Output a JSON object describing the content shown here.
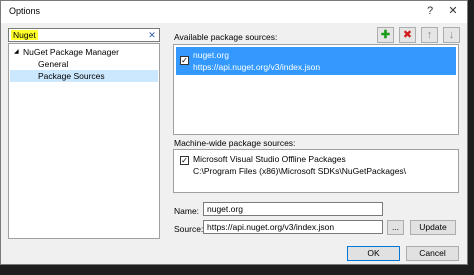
{
  "window": {
    "title": "Options",
    "help_glyph": "?",
    "close_glyph": "✕"
  },
  "search": {
    "value": "Nuget",
    "clear_glyph": "✕"
  },
  "tree": {
    "root": {
      "label": "NuGet Package Manager",
      "expander": "◢"
    },
    "children": [
      "General",
      "Package Sources"
    ],
    "selected_index": 1
  },
  "available": {
    "label": "Available package sources:",
    "items": [
      {
        "name": "nuget.org",
        "url": "https://api.nuget.org/v3/index.json",
        "checked": true
      }
    ]
  },
  "toolbar": {
    "add_glyph": "✚",
    "remove_glyph": "✖",
    "up_glyph": "↑",
    "down_glyph": "↓"
  },
  "machine_wide": {
    "label": "Machine-wide package sources:",
    "items": [
      {
        "name": "Microsoft Visual Studio Offline Packages",
        "path": "C:\\Program Files (x86)\\Microsoft SDKs\\NuGetPackages\\",
        "checked": true
      }
    ]
  },
  "form": {
    "name_label": "Name:",
    "name_value": "nuget.org",
    "source_label": "Source:",
    "source_value": "https://api.nuget.org/v3/index.json",
    "browse_label": "...",
    "update_label": "Update"
  },
  "buttons": {
    "ok": "OK",
    "cancel": "Cancel"
  },
  "colors": {
    "selection": "#3399ff",
    "search_highlight": "#ffff29",
    "add": "#1a9c1a",
    "remove": "#d11a1a"
  }
}
